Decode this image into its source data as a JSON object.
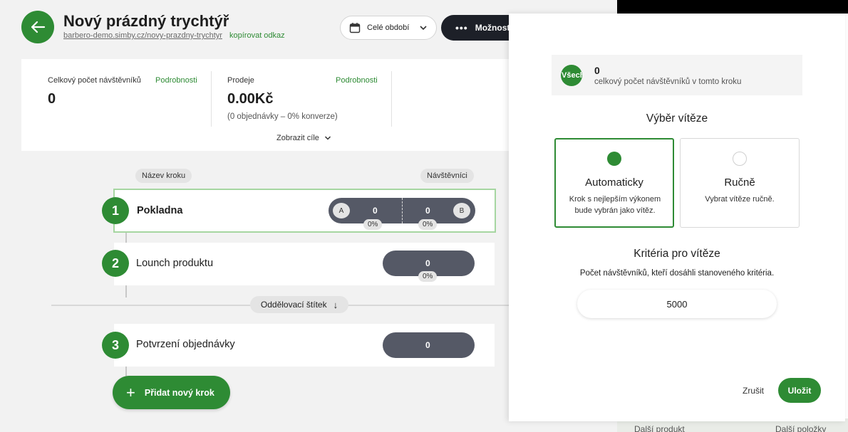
{
  "header": {
    "title": "Nový prázdný trychtýř",
    "url": "barbero-demo.simby.cz/novy-prazdny-trychtyr",
    "copy_link": "kopírovat odkaz",
    "period": "Celé období",
    "options": "Možnosti"
  },
  "stats": {
    "visitors_label": "Celkový počet návštěvníků",
    "visitors_link": "Podrobnosti",
    "visitors_value": "0",
    "sales_label": "Prodeje",
    "sales_link": "Podrobnosti",
    "sales_value": "0.00Kč",
    "sales_sub": "(0 objednávky – 0% konverze)",
    "show_goals": "Zobrazit cíle"
  },
  "columns": {
    "step_name": "Název kroku",
    "visitors": "Návštěvníci"
  },
  "steps": [
    {
      "number": "1",
      "name": "Pokladna",
      "variant_a": "A",
      "variant_b": "B",
      "value_a": "0",
      "value_b": "0",
      "pct_a": "0%",
      "pct_b": "0%"
    },
    {
      "number": "2",
      "name": "Lounch produktu",
      "value": "0",
      "pct": "0%"
    },
    {
      "number": "3",
      "name": "Potvrzení objednávky",
      "value": "0"
    }
  ],
  "separator": {
    "label": "Oddělovací štítek",
    "arrow": "↓"
  },
  "add_step": "Přidat nový krok",
  "background_right": {
    "bottom_left": "Další produkt",
    "bottom_right": "Další položky"
  },
  "panel": {
    "avatar": "Všech",
    "count": "0",
    "count_desc": "celkový počet návštěvníků v tomto kroku",
    "winner_title": "Výběr vítěze",
    "auto_title": "Automaticky",
    "auto_desc": "Krok s nejlepším výkonem bude vybrán jako vítěz.",
    "manual_title": "Ručně",
    "manual_desc": "Vybrat vítěze ručně.",
    "criteria_title": "Kritéria pro vítěze",
    "criteria_desc": "Počet návštěvníků, kteří dosáhli stanoveného kritéria.",
    "criteria_value": "5000",
    "cancel": "Zrušit",
    "save": "Uložit"
  },
  "colors": {
    "accent": "#2e8b34",
    "dark_pill": "#555966",
    "options_bg": "#1d2028"
  }
}
